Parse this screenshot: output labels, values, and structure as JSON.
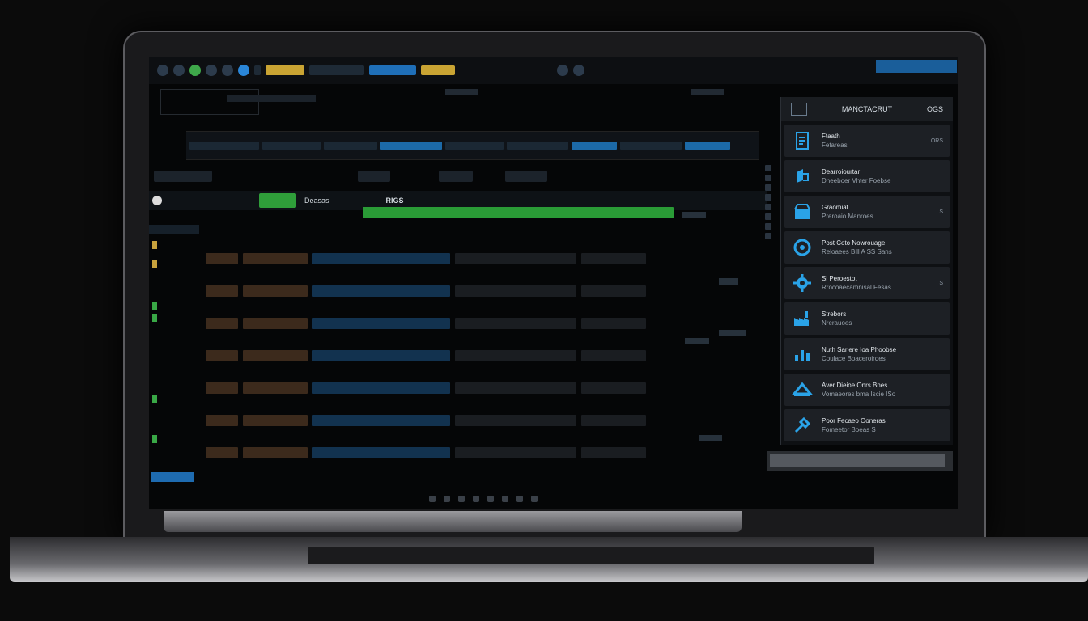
{
  "topbar": {
    "chips": [
      "",
      "",
      "",
      "",
      ""
    ],
    "right_label": ""
  },
  "strip": {
    "items": [
      "",
      "",
      "",
      "",
      "",
      "",
      "",
      "",
      ""
    ]
  },
  "subbar": {
    "items": [
      "",
      "",
      "",
      ""
    ]
  },
  "tabbar": {
    "green_tab": "",
    "tab_label": "Deasas",
    "center_label": "RIGS",
    "right_label": ""
  },
  "left_column": {
    "header": ""
  },
  "sidebar": {
    "header_title": "MANCTACRUT",
    "header_right": "OGS",
    "items": [
      {
        "title": "Ftaath",
        "subtitle": "Fetareas",
        "badge": "ORS",
        "icon": "document-icon"
      },
      {
        "title": "Dearroiourtar",
        "subtitle": "Dheeboer Vhter Foebse",
        "badge": "",
        "icon": "ship-icon"
      },
      {
        "title": "Graomiat",
        "subtitle": "Preroaio Manroes",
        "badge": "S",
        "icon": "store-icon"
      },
      {
        "title": "Post Coto Nowrouage",
        "subtitle": "Reloaees Bill A SS Sans",
        "badge": "",
        "icon": "cycle-icon"
      },
      {
        "title": "Sl Peroestot",
        "subtitle": "Rrocoaecamnisal Fesas",
        "badge": "S",
        "icon": "gear-icon"
      },
      {
        "title": "Strebors",
        "subtitle": "Nrerauoes",
        "badge": "",
        "icon": "factory-icon"
      },
      {
        "title": "Nuth Sariere Ioa Phoobse",
        "subtitle": "Coulace Boaceroirdes",
        "badge": "",
        "icon": "chart-icon"
      },
      {
        "title": "Aver Dieioe Onrs Bnes",
        "subtitle": "Vomaeores bma Iscie ISo",
        "badge": "",
        "icon": "truck-icon"
      },
      {
        "title": "Poor Fecaeo Ooneras",
        "subtitle": "Fomeetor Boeas S",
        "badge": "",
        "icon": "tools-icon"
      }
    ],
    "footer_button": ""
  },
  "colors": {
    "accent_blue": "#1f6fb8",
    "accent_green": "#2f9e3a",
    "icon_blue": "#2aa3e8"
  }
}
